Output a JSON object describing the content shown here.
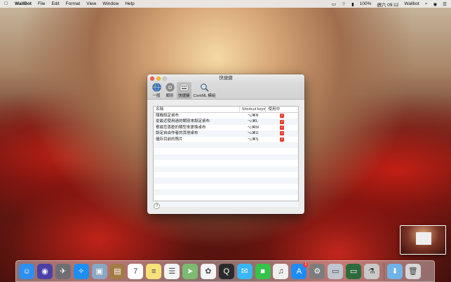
{
  "menubar": {
    "app_name": "WallBot",
    "menus": [
      "File",
      "Edit",
      "Format",
      "View",
      "Window",
      "Help"
    ],
    "battery": "100%",
    "clock": "週六 09:12",
    "app_status": "Wallbot"
  },
  "window": {
    "title": "快捷鍵",
    "toolbar": [
      {
        "label": "一般",
        "icon": "globe-icon"
      },
      {
        "label": "類別",
        "icon": "gear-icon"
      },
      {
        "label": "快捷鍵",
        "icon": "keyboard-icon"
      },
      {
        "label": "CoreML 模組",
        "icon": "magnifier-icon"
      }
    ],
    "table": {
      "headers": [
        "名稱",
        "Shortcut keys",
        "使用中"
      ],
      "rows": [
        {
          "name": "隨機設定桌布",
          "keys": "⌥⌘N",
          "enabled": true
        },
        {
          "name": "從最近使用過的類別來設定桌布",
          "keys": "⌥⌘L",
          "enabled": true
        },
        {
          "name": "根據您喜歡的類型來更換桌布",
          "keys": "⌥⌘M",
          "enabled": true
        },
        {
          "name": "設定自由作者的其他桌布",
          "keys": "⌥⌘U",
          "enabled": true
        },
        {
          "name": "儲存目前的照片",
          "keys": "⌥⌘S",
          "enabled": true
        }
      ],
      "empty_rows": 11
    },
    "help_label": "?"
  },
  "dock": {
    "apps": [
      {
        "name": "finder",
        "glyph": "☺",
        "color": "#2f8ff0"
      },
      {
        "name": "siri",
        "glyph": "◉",
        "color": "#4b3fa8"
      },
      {
        "name": "launchpad",
        "glyph": "✈",
        "color": "#6e6e73"
      },
      {
        "name": "safari",
        "glyph": "✧",
        "color": "#1d8ff2"
      },
      {
        "name": "preview",
        "glyph": "▣",
        "color": "#8aa7c4"
      },
      {
        "name": "notes-book",
        "glyph": "▤",
        "color": "#a47a45"
      },
      {
        "name": "calendar",
        "glyph": "7",
        "color": "#ffffff"
      },
      {
        "name": "notes",
        "glyph": "≡",
        "color": "#f7e27a"
      },
      {
        "name": "reminders",
        "glyph": "☰",
        "color": "#f4f4f4"
      },
      {
        "name": "maps",
        "glyph": "➤",
        "color": "#7dbb72"
      },
      {
        "name": "photos",
        "glyph": "✿",
        "color": "#f5f5f5"
      },
      {
        "name": "quicktime",
        "glyph": "Q",
        "color": "#2b2b2b"
      },
      {
        "name": "messages",
        "glyph": "✉",
        "color": "#39b6f4"
      },
      {
        "name": "facetime",
        "glyph": "■",
        "color": "#37c24a"
      },
      {
        "name": "music",
        "glyph": "♫",
        "color": "#f0f0f0"
      },
      {
        "name": "app-store",
        "glyph": "A",
        "color": "#1f8cf5",
        "badge": "1"
      },
      {
        "name": "system-preferences",
        "glyph": "⚙",
        "color": "#7d7d7d"
      },
      {
        "name": "photo-viewer",
        "glyph": "▭",
        "color": "#bfc6cf"
      },
      {
        "name": "monitor",
        "glyph": "▭",
        "color": "#2d6a3b"
      },
      {
        "name": "scripts",
        "glyph": "⚗",
        "color": "#c9c9c9"
      }
    ],
    "right": [
      {
        "name": "downloads-folder",
        "glyph": "⬇",
        "color": "#6fb4e8"
      },
      {
        "name": "trash",
        "glyph": "🗑",
        "color": "#d7d7d7"
      }
    ]
  }
}
